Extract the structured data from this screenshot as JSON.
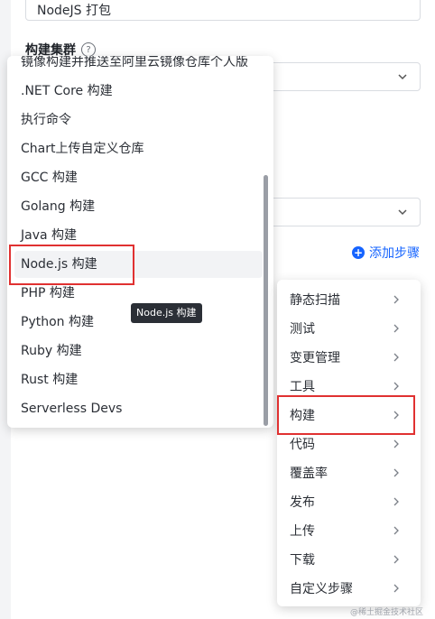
{
  "form": {
    "name_value": "NodeJS 打包",
    "cluster_label": "构建集群",
    "help_icon": "?"
  },
  "add_step": {
    "label": "添加步骤"
  },
  "left_menu": {
    "items": [
      "镜像构建并推送至阿里云镜像仓库个人版",
      ".NET Core 构建",
      "执行命令",
      "Chart上传自定义仓库",
      "GCC 构建",
      "Golang 构建",
      "Java 构建",
      "Node.js 构建",
      "PHP 构建",
      "Python 构建",
      "Ruby 构建",
      "Rust 构建",
      "Serverless Devs"
    ],
    "hovered_item": "Node.js 构建"
  },
  "tooltip": {
    "text": "Node.js 构建"
  },
  "right_menu": {
    "items": [
      "静态扫描",
      "测试",
      "变更管理",
      "工具",
      "构建",
      "代码",
      "覆盖率",
      "发布",
      "上传",
      "下载",
      "自定义步骤"
    ],
    "highlighted_item": "构建"
  },
  "annotation_color": "#e03131",
  "accent_color": "#1664ff",
  "watermark": "@稀土掘金技术社区"
}
